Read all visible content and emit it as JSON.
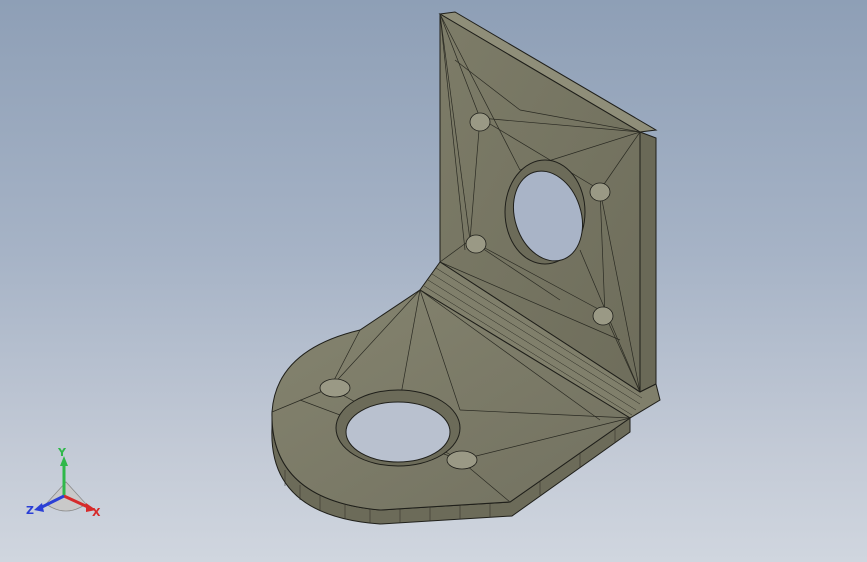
{
  "viewport": {
    "model_color": "#7a7a66",
    "model_dark": "#5a5a4a",
    "model_light": "#8b8b77",
    "edge_color": "#1f1f1a",
    "background_top": "#8e9fb6",
    "background_bottom": "#d0d6df"
  },
  "triad": {
    "y_label": "Y",
    "z_label": "Z",
    "x_label": "X",
    "y_color": "#2fb84a",
    "z_color": "#2a3fd6",
    "x_color": "#d62a2a"
  }
}
